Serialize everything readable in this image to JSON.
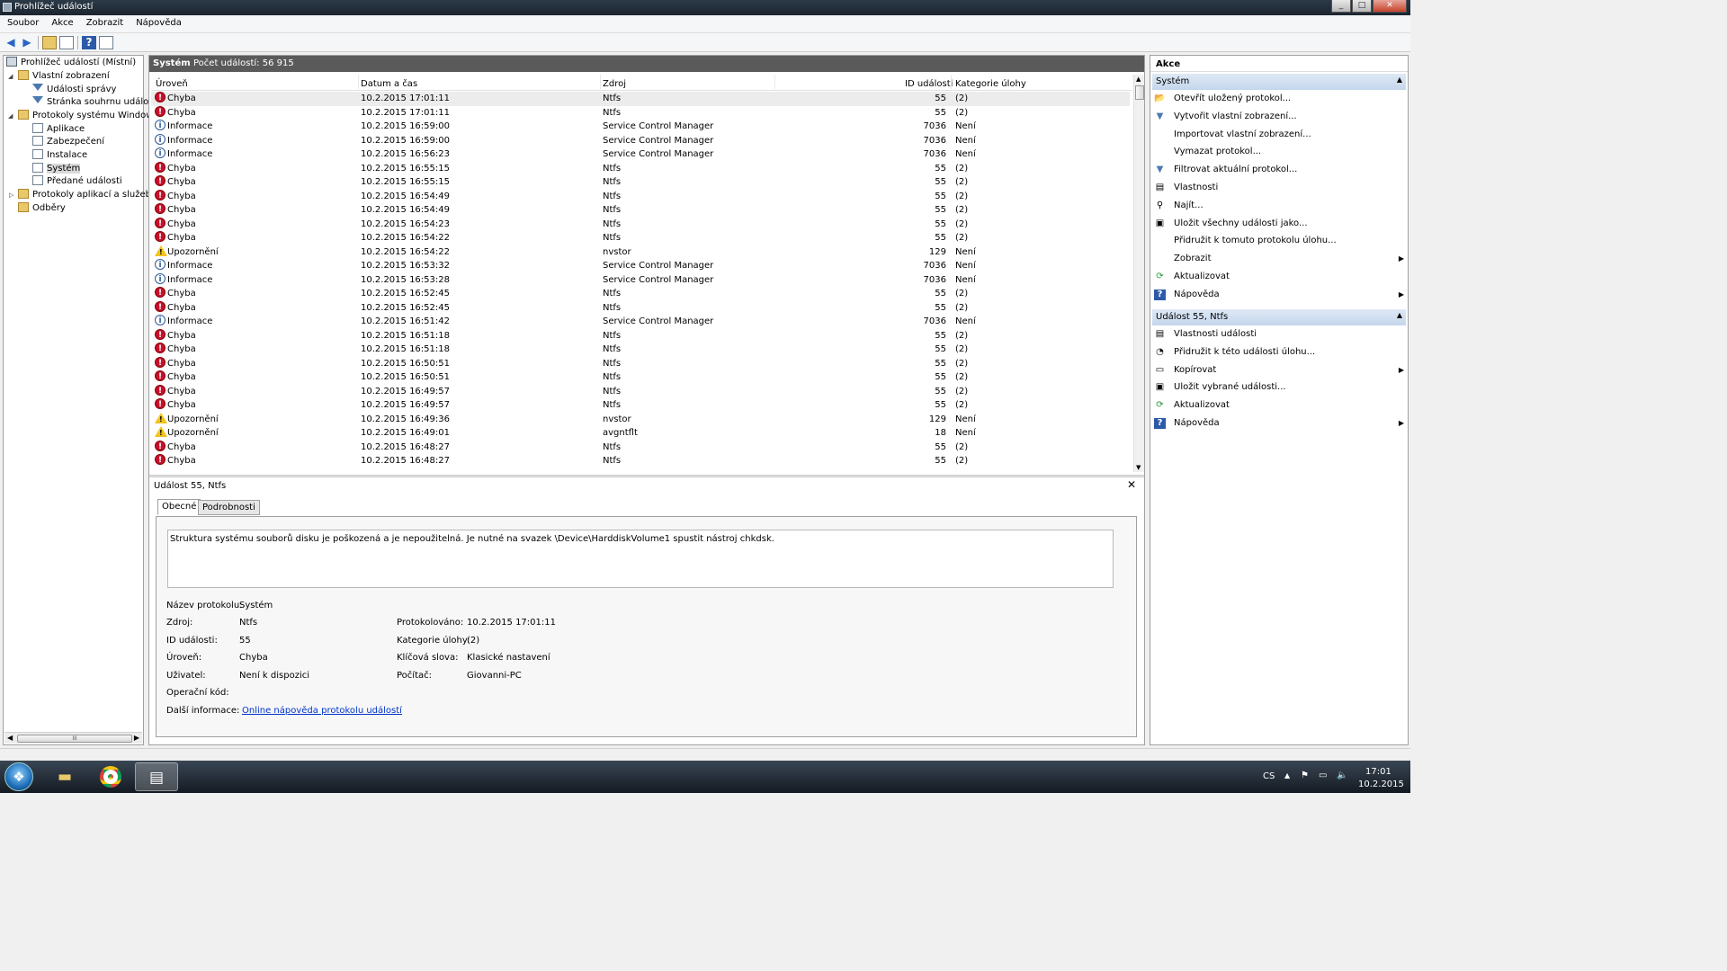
{
  "window": {
    "title": "Prohlížeč událostí",
    "btn_min": "_",
    "btn_max": "□",
    "btn_close": "✕"
  },
  "menu": [
    "Soubor",
    "Akce",
    "Zobrazit",
    "Nápověda"
  ],
  "tree": {
    "root": "Prohlížeč událostí (Místní)",
    "custom_views": "Vlastní zobrazení",
    "admin_events": "Události správy",
    "summary_page": "Stránka souhrnu událostí",
    "windows_logs": "Protokoly systému Windows",
    "apps": "Aplikace",
    "security": "Zabezpečení",
    "setup": "Instalace",
    "system": "Systém",
    "forwarded": "Předané události",
    "app_service_logs": "Protokoly aplikací a služeb",
    "subscriptions": "Odběry",
    "scroll_grip": "III"
  },
  "log": {
    "name": "Systém",
    "count_label": "Počet událostí: 56 915"
  },
  "columns": {
    "level": "Úroveň",
    "datetime": "Datum a čas",
    "source": "Zdroj",
    "event_id": "ID události",
    "category": "Kategorie úlohy"
  },
  "events": [
    {
      "level": "Chyba",
      "type": "err",
      "datetime": "10.2.2015 17:01:11",
      "source": "Ntfs",
      "id": "55",
      "cat": "(2)"
    },
    {
      "level": "Chyba",
      "type": "err",
      "datetime": "10.2.2015 17:01:11",
      "source": "Ntfs",
      "id": "55",
      "cat": "(2)"
    },
    {
      "level": "Informace",
      "type": "info",
      "datetime": "10.2.2015 16:59:00",
      "source": "Service Control Manager",
      "id": "7036",
      "cat": "Není"
    },
    {
      "level": "Informace",
      "type": "info",
      "datetime": "10.2.2015 16:59:00",
      "source": "Service Control Manager",
      "id": "7036",
      "cat": "Není"
    },
    {
      "level": "Informace",
      "type": "info",
      "datetime": "10.2.2015 16:56:23",
      "source": "Service Control Manager",
      "id": "7036",
      "cat": "Není"
    },
    {
      "level": "Chyba",
      "type": "err",
      "datetime": "10.2.2015 16:55:15",
      "source": "Ntfs",
      "id": "55",
      "cat": "(2)"
    },
    {
      "level": "Chyba",
      "type": "err",
      "datetime": "10.2.2015 16:55:15",
      "source": "Ntfs",
      "id": "55",
      "cat": "(2)"
    },
    {
      "level": "Chyba",
      "type": "err",
      "datetime": "10.2.2015 16:54:49",
      "source": "Ntfs",
      "id": "55",
      "cat": "(2)"
    },
    {
      "level": "Chyba",
      "type": "err",
      "datetime": "10.2.2015 16:54:49",
      "source": "Ntfs",
      "id": "55",
      "cat": "(2)"
    },
    {
      "level": "Chyba",
      "type": "err",
      "datetime": "10.2.2015 16:54:23",
      "source": "Ntfs",
      "id": "55",
      "cat": "(2)"
    },
    {
      "level": "Chyba",
      "type": "err",
      "datetime": "10.2.2015 16:54:22",
      "source": "Ntfs",
      "id": "55",
      "cat": "(2)"
    },
    {
      "level": "Upozornění",
      "type": "warn",
      "datetime": "10.2.2015 16:54:22",
      "source": "nvstor",
      "id": "129",
      "cat": "Není"
    },
    {
      "level": "Informace",
      "type": "info",
      "datetime": "10.2.2015 16:53:32",
      "source": "Service Control Manager",
      "id": "7036",
      "cat": "Není"
    },
    {
      "level": "Informace",
      "type": "info",
      "datetime": "10.2.2015 16:53:28",
      "source": "Service Control Manager",
      "id": "7036",
      "cat": "Není"
    },
    {
      "level": "Chyba",
      "type": "err",
      "datetime": "10.2.2015 16:52:45",
      "source": "Ntfs",
      "id": "55",
      "cat": "(2)"
    },
    {
      "level": "Chyba",
      "type": "err",
      "datetime": "10.2.2015 16:52:45",
      "source": "Ntfs",
      "id": "55",
      "cat": "(2)"
    },
    {
      "level": "Informace",
      "type": "info",
      "datetime": "10.2.2015 16:51:42",
      "source": "Service Control Manager",
      "id": "7036",
      "cat": "Není"
    },
    {
      "level": "Chyba",
      "type": "err",
      "datetime": "10.2.2015 16:51:18",
      "source": "Ntfs",
      "id": "55",
      "cat": "(2)"
    },
    {
      "level": "Chyba",
      "type": "err",
      "datetime": "10.2.2015 16:51:18",
      "source": "Ntfs",
      "id": "55",
      "cat": "(2)"
    },
    {
      "level": "Chyba",
      "type": "err",
      "datetime": "10.2.2015 16:50:51",
      "source": "Ntfs",
      "id": "55",
      "cat": "(2)"
    },
    {
      "level": "Chyba",
      "type": "err",
      "datetime": "10.2.2015 16:50:51",
      "source": "Ntfs",
      "id": "55",
      "cat": "(2)"
    },
    {
      "level": "Chyba",
      "type": "err",
      "datetime": "10.2.2015 16:49:57",
      "source": "Ntfs",
      "id": "55",
      "cat": "(2)"
    },
    {
      "level": "Chyba",
      "type": "err",
      "datetime": "10.2.2015 16:49:57",
      "source": "Ntfs",
      "id": "55",
      "cat": "(2)"
    },
    {
      "level": "Upozornění",
      "type": "warn",
      "datetime": "10.2.2015 16:49:36",
      "source": "nvstor",
      "id": "129",
      "cat": "Není"
    },
    {
      "level": "Upozornění",
      "type": "warn",
      "datetime": "10.2.2015 16:49:01",
      "source": "avgntflt",
      "id": "18",
      "cat": "Není"
    },
    {
      "level": "Chyba",
      "type": "err",
      "datetime": "10.2.2015 16:48:27",
      "source": "Ntfs",
      "id": "55",
      "cat": "(2)"
    },
    {
      "level": "Chyba",
      "type": "err",
      "datetime": "10.2.2015 16:48:27",
      "source": "Ntfs",
      "id": "55",
      "cat": "(2)"
    }
  ],
  "detail": {
    "title": "Událost 55, Ntfs",
    "close": "✕",
    "tab_general": "Obecné",
    "tab_details": "Podrobnosti",
    "description": "Struktura systému souborů disku je poškozená a je nepoužitelná. Je nutné na svazek \\Device\\HarddiskVolume1 spustit nástroj chkdsk.",
    "log_name_label": "Název protokolu:",
    "log_name": "Systém",
    "source_label": "Zdroj:",
    "source": "Ntfs",
    "logged_label": "Protokolováno:",
    "logged": "10.2.2015 17:01:11",
    "id_label": "ID události:",
    "id": "55",
    "category_label": "Kategorie úlohy:",
    "category": "(2)",
    "level_label": "Úroveň:",
    "level": "Chyba",
    "keywords_label": "Klíčová slova:",
    "keywords": "Klasické nastavení",
    "user_label": "Uživatel:",
    "user": "Není k dispozici",
    "computer_label": "Počítač:",
    "computer": "Giovanni-PC",
    "opcode_label": "Operační kód:",
    "more_label": "Další informace:",
    "more_link": "Online nápověda protokolu událostí"
  },
  "actions": {
    "header": "Akce",
    "section1": "Systém",
    "items1": [
      {
        "label": "Otevřít uložený protokol...",
        "icon": "📂"
      },
      {
        "label": "Vytvořit vlastní zobrazení...",
        "icon": "▼"
      },
      {
        "label": "Importovat vlastní zobrazení...",
        "icon": ""
      },
      {
        "label": "Vymazat protokol...",
        "icon": ""
      },
      {
        "label": "Filtrovat aktuální protokol...",
        "icon": "▼"
      },
      {
        "label": "Vlastnosti",
        "icon": "▤"
      },
      {
        "label": "Najít...",
        "icon": "⚲"
      },
      {
        "label": "Uložit všechny události jako...",
        "icon": "▣"
      },
      {
        "label": "Přidružit k tomuto protokolu úlohu...",
        "icon": ""
      },
      {
        "label": "Zobrazit",
        "icon": "",
        "sub": "▶"
      },
      {
        "label": "Aktualizovat",
        "icon": "⟳"
      },
      {
        "label": "Nápověda",
        "icon": "?",
        "sub": "▶"
      }
    ],
    "section2": "Událost 55, Ntfs",
    "items2": [
      {
        "label": "Vlastnosti události",
        "icon": "▤"
      },
      {
        "label": "Přidružit k této události úlohu...",
        "icon": "◔"
      },
      {
        "label": "Kopírovat",
        "icon": "▭",
        "sub": "▶"
      },
      {
        "label": "Uložit vybrané události...",
        "icon": "▣"
      },
      {
        "label": "Aktualizovat",
        "icon": "⟳"
      },
      {
        "label": "Nápověda",
        "icon": "?",
        "sub": "▶"
      }
    ]
  },
  "taskbar": {
    "lang": "CS",
    "time": "17:01",
    "date": "10.2.2015"
  }
}
